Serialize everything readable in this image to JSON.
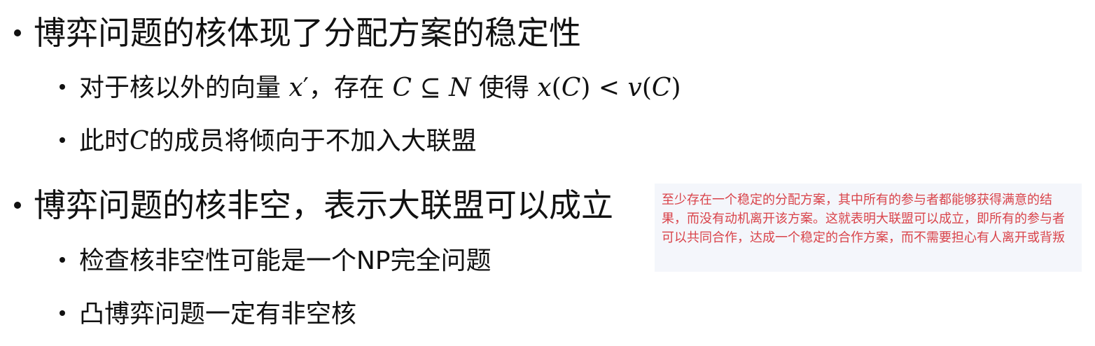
{
  "bullets": {
    "b1": "博弈问题的核体现了分配方案的稳定性",
    "b1_sub1": {
      "prefix": "对于核以外的向量",
      "var_x": "x",
      "prime": "′",
      "mid": "，存在",
      "set_c": "C",
      "subseteq": "⊆",
      "set_n": "N",
      "then": "使得",
      "expr_x": "x",
      "open1": "(",
      "expr_c1": "C",
      "close1": ")",
      "lt": "<",
      "expr_v": "v",
      "open2": "(",
      "expr_c2": "C",
      "close2": ")"
    },
    "b1_sub2": {
      "prefix": "此时",
      "set_c": "C",
      "suffix": "的成员将倾向于不加入大联盟"
    },
    "b2": "博弈问题的核非空，表示大联盟可以成立",
    "b2_sub1": "检查核非空性可能是一个NP完全问题",
    "b2_sub2": "凸博弈问题一定有非空核"
  },
  "note": {
    "text": "至少存在一个稳定的分配方案，其中所有的参与者都能够获得满意的结果，而没有动机离开该方案。这就表明大联盟可以成立，即所有的参与者可以共同合作，达成一个稳定的合作方案，而不需要担心有人离开或背叛"
  }
}
